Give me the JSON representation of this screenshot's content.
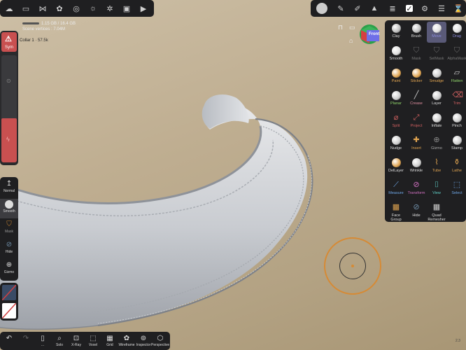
{
  "colors": {
    "accent": "#7b7bd6",
    "panel": "#1f1f21",
    "symRed": "#c95050",
    "brushRing": "#d68a35"
  },
  "topbar_left_icons": [
    "cloud-icon",
    "folder-icon",
    "share-icon",
    "scene-icon",
    "sphere-icon",
    "sun-icon",
    "gear-icon",
    "image-icon",
    "video-icon"
  ],
  "topbar_right_icons": [
    "material-icon",
    "pen-icon",
    "brush-icon",
    "warning-icon",
    "layers-icon",
    "settings-icon",
    "menu-icon",
    "history-icon"
  ],
  "info": {
    "memory": "1.15 GB / 16.4 GB",
    "vertices_label": "Scene vertices :",
    "vertices": "7.04M"
  },
  "mesh": {
    "name": "Collar 1",
    "size": "57.5k"
  },
  "left": {
    "sym_label": "Sym"
  },
  "left_tools": [
    {
      "name": "normal",
      "label": "Normal"
    },
    {
      "name": "smooth",
      "label": "Smooth"
    },
    {
      "name": "mask",
      "label": "Mask"
    },
    {
      "name": "hide",
      "label": "Hide"
    },
    {
      "name": "gizmo",
      "label": "Gizmo"
    }
  ],
  "cube": {
    "label": "Front"
  },
  "tools": [
    {
      "name": "clay",
      "label": "Clay",
      "color": "#dddddd",
      "icon": "#bbbbbb"
    },
    {
      "name": "brush",
      "label": "Brush",
      "color": "#dddddd",
      "icon": "#bbbbbb"
    },
    {
      "name": "move",
      "label": "Move",
      "color": "#8f8fe0",
      "icon": "#dddddd",
      "selected": true
    },
    {
      "name": "drag",
      "label": "Drag",
      "color": "#8f8fe0",
      "icon": "#dddddd"
    },
    {
      "name": "smooth",
      "label": "Smooth",
      "color": "#dddddd",
      "icon": "#dddddd"
    },
    {
      "name": "mask",
      "label": "Mask",
      "color": "#777777",
      "icon": "#666666"
    },
    {
      "name": "selmask",
      "label": "SelMask",
      "color": "#777777",
      "icon": "#666666"
    },
    {
      "name": "alphamask",
      "label": "AlphaMask",
      "color": "#777777",
      "icon": "#666666"
    },
    {
      "name": "paint",
      "label": "Paint",
      "color": "#e0a450",
      "icon": "#e0a450"
    },
    {
      "name": "sticker",
      "label": "Sticker",
      "color": "#e0a450",
      "icon": "#e0a450"
    },
    {
      "name": "smudge",
      "label": "Smudge",
      "color": "#e0a450",
      "icon": "#cccccc"
    },
    {
      "name": "flatten",
      "label": "Flatten",
      "color": "#8fd36a",
      "icon": "#cccccc"
    },
    {
      "name": "planar",
      "label": "Planar",
      "color": "#8fd36a",
      "icon": "#cccccc"
    },
    {
      "name": "crease",
      "label": "Crease",
      "color": "#e08fa0",
      "icon": "#cccccc"
    },
    {
      "name": "layer",
      "label": "Layer",
      "color": "#dddddd",
      "icon": "#cccccc"
    },
    {
      "name": "trim",
      "label": "Trim",
      "color": "#d06060",
      "icon": "#d06060"
    },
    {
      "name": "split",
      "label": "Split",
      "color": "#d06060",
      "icon": "#d06060"
    },
    {
      "name": "project",
      "label": "Project",
      "color": "#d06060",
      "icon": "#d06060"
    },
    {
      "name": "inflate",
      "label": "Inflate",
      "color": "#dddddd",
      "icon": "#cccccc"
    },
    {
      "name": "pinch",
      "label": "Pinch",
      "color": "#dddddd",
      "icon": "#cccccc"
    },
    {
      "name": "nudge",
      "label": "Nudge",
      "color": "#dddddd",
      "icon": "#cccccc"
    },
    {
      "name": "insert",
      "label": "Insert",
      "color": "#e0a450",
      "icon": "#e0a450"
    },
    {
      "name": "gizmo",
      "label": "Gizmo",
      "color": "#aaaaaa",
      "icon": "#888888"
    },
    {
      "name": "stamp",
      "label": "Stamp",
      "color": "#dddddd",
      "icon": "#cccccc"
    },
    {
      "name": "dellayer",
      "label": "DelLayer",
      "color": "#dddddd",
      "icon": "#e0a450"
    },
    {
      "name": "wrinkle",
      "label": "Wrinkle",
      "color": "#dddddd",
      "icon": "#cccccc"
    },
    {
      "name": "tube",
      "label": "Tube",
      "color": "#e0a450",
      "icon": "#e0a450"
    },
    {
      "name": "lathe",
      "label": "Lathe",
      "color": "#e0a450",
      "icon": "#e0a450"
    },
    {
      "name": "measure",
      "label": "Measure",
      "color": "#6fa8e8",
      "icon": "#6fa8e8"
    },
    {
      "name": "transform",
      "label": "Transform",
      "color": "#d070c0",
      "icon": "#d070c0"
    },
    {
      "name": "view",
      "label": "View",
      "color": "#5fd0c8",
      "icon": "#5fd0c8"
    },
    {
      "name": "select",
      "label": "Select",
      "color": "#6fa8e8",
      "icon": "#6fa8e8"
    },
    {
      "name": "facegroup",
      "label": "Face Group",
      "color": "#dddddd",
      "icon": "#e0a450"
    },
    {
      "name": "hide",
      "label": "Hide",
      "color": "#dddddd",
      "icon": "#6f8ea8"
    },
    {
      "name": "quadremesher",
      "label": "Quad\nRemesher",
      "color": "#dddddd",
      "icon": "#cccccc"
    }
  ],
  "bottombar": [
    {
      "name": "undo",
      "label": ""
    },
    {
      "name": "redo",
      "label": ""
    },
    {
      "name": "layers",
      "label": "..."
    },
    {
      "name": "solo",
      "label": "Solo"
    },
    {
      "name": "xray",
      "label": "X-Ray"
    },
    {
      "name": "voxel",
      "label": "Voxel"
    },
    {
      "name": "grid",
      "label": "Grid"
    },
    {
      "name": "wireframe",
      "label": "Wireframe"
    },
    {
      "name": "inspector",
      "label": "Inspector"
    },
    {
      "name": "perspective",
      "label": "Perspective"
    }
  ],
  "version": "2.3"
}
